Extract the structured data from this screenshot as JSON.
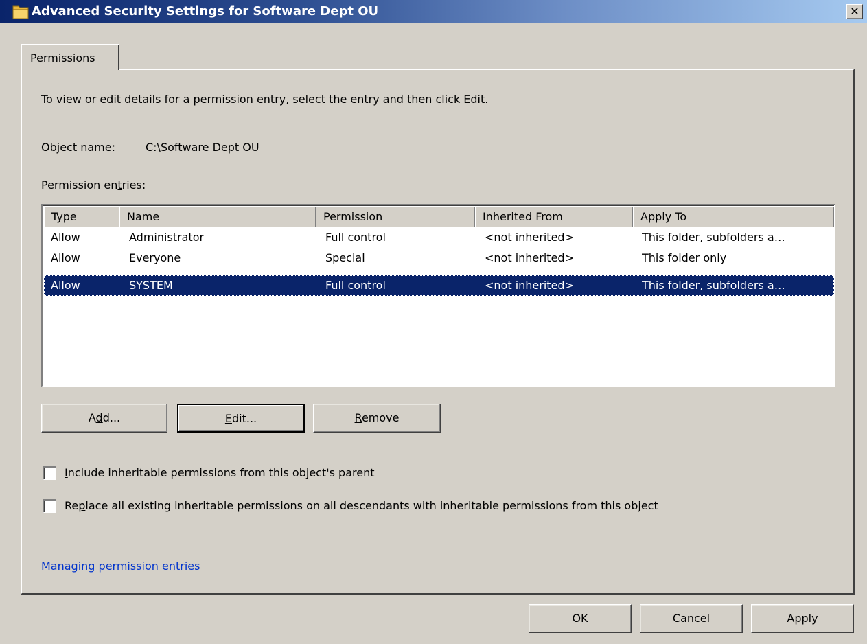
{
  "window": {
    "title": "Advanced Security Settings for Software Dept OU",
    "close_label": "✕"
  },
  "tabs": [
    {
      "label": "Permissions",
      "selected": true
    }
  ],
  "instructions": "To view or edit details for a permission entry, select the entry and then click Edit.",
  "object_name": {
    "label": "Object name:",
    "value": "C:\\Software Dept OU"
  },
  "entries_label": {
    "pre": "Permission en",
    "underlined": "t",
    "post": "ries:"
  },
  "table": {
    "columns": [
      "Type",
      "Name",
      "Permission",
      "Inherited From",
      "Apply To"
    ],
    "rows": [
      {
        "type": "Allow",
        "name": "Administrator",
        "permission": "Full control",
        "inherited_from": "<not inherited>",
        "apply_to": "This folder, subfolders a…",
        "selected": false
      },
      {
        "type": "Allow",
        "name": "Everyone",
        "permission": "Special",
        "inherited_from": "<not inherited>",
        "apply_to": "This folder only",
        "selected": false
      },
      {
        "type": "Allow",
        "name": "SYSTEM",
        "permission": "Full control",
        "inherited_from": "<not inherited>",
        "apply_to": "This folder, subfolders a…",
        "selected": true
      }
    ]
  },
  "buttons": {
    "add": {
      "pre": "A",
      "underlined": "d",
      "post": "d..."
    },
    "edit": {
      "pre": "",
      "underlined": "E",
      "post": "dit..."
    },
    "remove": {
      "pre": "",
      "underlined": "R",
      "post": "emove"
    }
  },
  "checkboxes": {
    "include": {
      "pre": "",
      "underlined": "I",
      "post": "nclude inheritable permissions from this object's parent",
      "checked": false
    },
    "replace": {
      "pre": "Re",
      "underlined": "p",
      "post": "lace all existing inheritable permissions on all descendants with inheritable permissions from this object",
      "checked": false
    }
  },
  "help_link": "Managing permission entries",
  "footer": {
    "ok": "OK",
    "cancel": "Cancel",
    "apply": {
      "pre": "",
      "underlined": "A",
      "post": "pply"
    }
  },
  "colors": {
    "selection": "#0a246a",
    "link": "#0033cc",
    "face": "#d4d0c8"
  },
  "icons": {
    "title_icon": "folder-icon"
  }
}
